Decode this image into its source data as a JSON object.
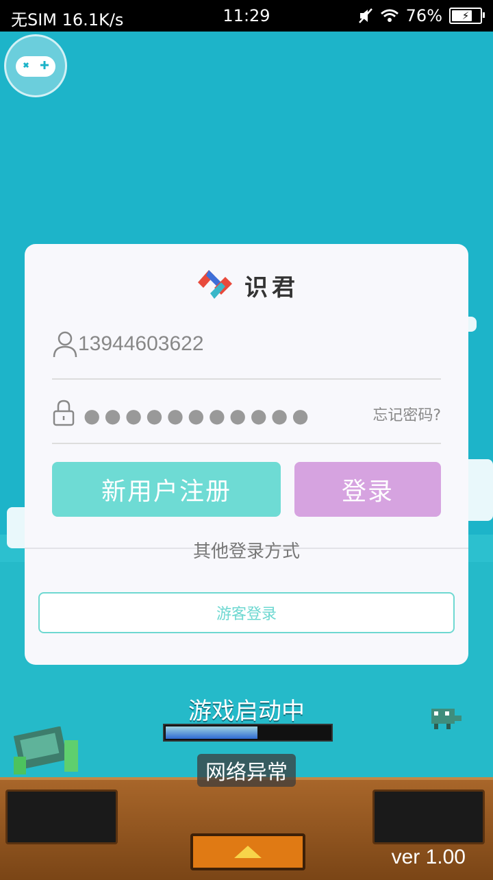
{
  "status_bar": {
    "carrier": "无SIM 16.1K/s",
    "time": "11:29",
    "battery": "76%",
    "battery_level": 0.76
  },
  "login": {
    "brand": "识君",
    "username_value": "13944603622",
    "password_mask": "●●●●●●●●●●●",
    "forgot_label": "忘记密码?",
    "register_label": "新用户注册",
    "login_label": "登录",
    "other_methods_label": "其他登录方式",
    "guest_label": "游客登录"
  },
  "game": {
    "loading_label": "游戏启动中",
    "progress": 0.55,
    "toast": "网络异常",
    "version": "ver 1.00"
  },
  "icons": {
    "gamepad": "gamepad-icon",
    "user": "user-icon",
    "lock": "lock-icon",
    "wifi": "wifi-icon",
    "mute": "mute-icon",
    "up_arrow": "up-arrow-icon"
  },
  "colors": {
    "register_button": "#6edbd4",
    "login_button": "#d6a3e0",
    "guest_border": "#6ed8d1",
    "background": "#1cb3c8"
  }
}
